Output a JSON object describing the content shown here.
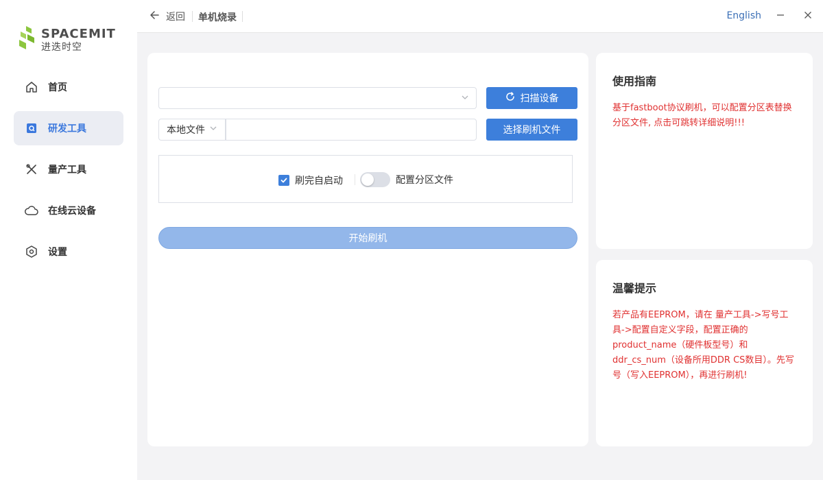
{
  "brand": {
    "name_en": "SPACEMIT",
    "name_cn": "进迭时空",
    "logo_color": "#8cc63f"
  },
  "sidebar": {
    "items": [
      {
        "label": "首页",
        "icon": "home-icon"
      },
      {
        "label": "研发工具",
        "icon": "dev-tools-icon",
        "active": true
      },
      {
        "label": "量产工具",
        "icon": "tools-icon"
      },
      {
        "label": "在线云设备",
        "icon": "cloud-icon"
      },
      {
        "label": "设置",
        "icon": "settings-icon"
      }
    ]
  },
  "header": {
    "back_label": "返回",
    "breadcrumb": "单机烧录",
    "language": "English"
  },
  "flash": {
    "device_select_value": "",
    "scan_label": "扫描设备",
    "file_source": "本地文件",
    "file_path": "",
    "choose_file_label": "选择刷机文件",
    "auto_boot_label": "刷完自启动",
    "auto_boot_checked": true,
    "partition_label": "配置分区文件",
    "partition_enabled": false,
    "start_label": "开始刷机"
  },
  "guide": {
    "title": "使用指南",
    "text": "基于fastboot协议刷机，可以配置分区表替换分区文件, 点击可跳转详细说明!!!"
  },
  "tips": {
    "title": "温馨提示",
    "text": "若产品有EEPROM，请在 量产工具->写号工具->配置自定义字段，配置正确的product_name（硬件板型号）和ddr_cs_num（设备所用DDR CS数目）。先写号（写入EEPROM），再进行刷机!"
  },
  "colors": {
    "primary": "#3d7fdb",
    "start_disabled": "#93b7ea",
    "warning_text": "#e03131",
    "active_nav_bg": "#ebedf3"
  }
}
